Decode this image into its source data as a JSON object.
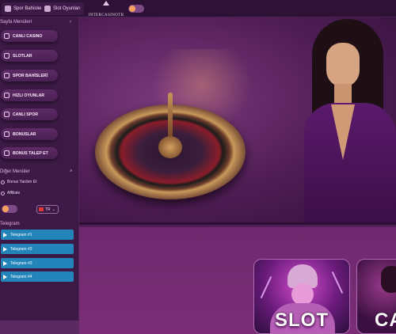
{
  "topbar": {
    "sports_bets_label": "Spor Bahisleri",
    "slot_games_label": "Slot Oyunları",
    "logo_text": "INTERCASINOTR"
  },
  "sidebar": {
    "section_title": "Sayfa Menüleri",
    "items": [
      {
        "label": "CANLI CASINO",
        "icon": "chip-icon"
      },
      {
        "label": "SLOTLAR",
        "icon": "slot-icon"
      },
      {
        "label": "SPOR BAHİSLERİ",
        "icon": "ball-icon"
      },
      {
        "label": "HIZLI OYUNLAR",
        "icon": "gamepad-icon"
      },
      {
        "label": "CANLI SPOR",
        "icon": "broadcast-icon"
      },
      {
        "label": "BONUSLAR",
        "icon": "gift-icon"
      },
      {
        "label": "BONUS TALEP ET",
        "icon": "bonus-icon"
      }
    ],
    "other_title": "Diğer Menüler",
    "other_items": [
      {
        "label": "Bonus Yardım Et",
        "icon": "headset-icon"
      },
      {
        "label": "Affiliate",
        "icon": "affiliate-icon"
      }
    ],
    "language": "TR",
    "telegram_title": "Telegram",
    "telegram": [
      "Telegram #1",
      "Telegram #2",
      "Telegram #3",
      "Telegram #4"
    ]
  },
  "cards": [
    {
      "label": "SLOT"
    },
    {
      "label": "CA"
    }
  ],
  "colors": {
    "background": "#3a1842",
    "telegram_button": "#2284b8",
    "toggle_knob": "#f6a15a"
  }
}
